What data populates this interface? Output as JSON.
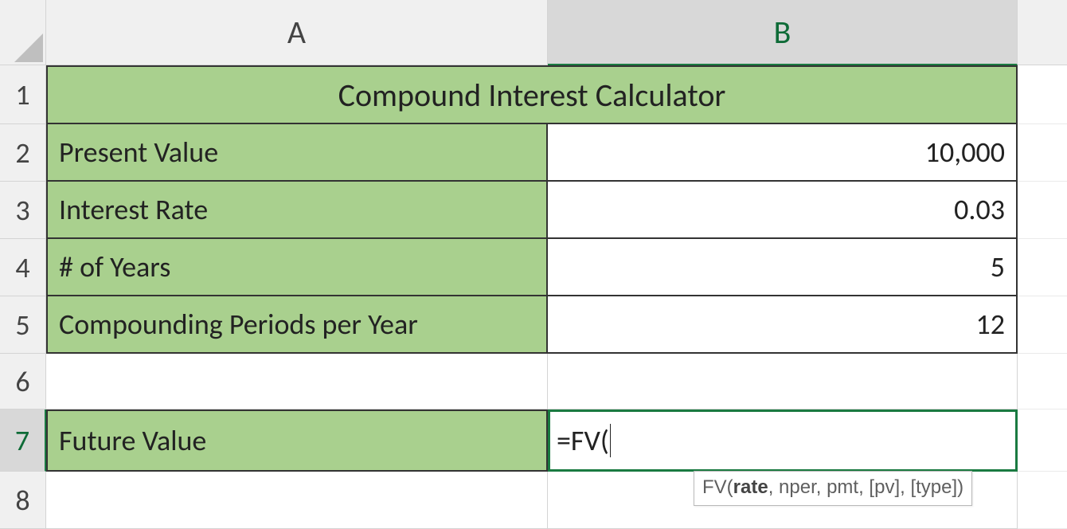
{
  "columns": {
    "A": "A",
    "B": "B"
  },
  "rows": [
    "1",
    "2",
    "3",
    "4",
    "5",
    "6",
    "7",
    "8"
  ],
  "heights": {
    "r1": 74,
    "r2": 72,
    "r3": 72,
    "r4": 72,
    "r5": 72,
    "r6": 70,
    "r7": 78,
    "r8": 72
  },
  "title": "Compound Interest Calculator",
  "labels": {
    "present_value": "Present Value",
    "interest_rate": "Interest Rate",
    "years": "# of Years",
    "periods": "Compounding Periods per Year",
    "future_value": "Future Value"
  },
  "values": {
    "present_value": "10,000",
    "interest_rate": "0.03",
    "years": "5",
    "periods": "12"
  },
  "formula": "=FV(",
  "hint": {
    "fn": "FV(",
    "arg_active": "rate",
    "rest": ", nper, pmt, [pv], [type])"
  },
  "colors": {
    "accent": "#a9d08e",
    "selection": "#1a7a41"
  }
}
